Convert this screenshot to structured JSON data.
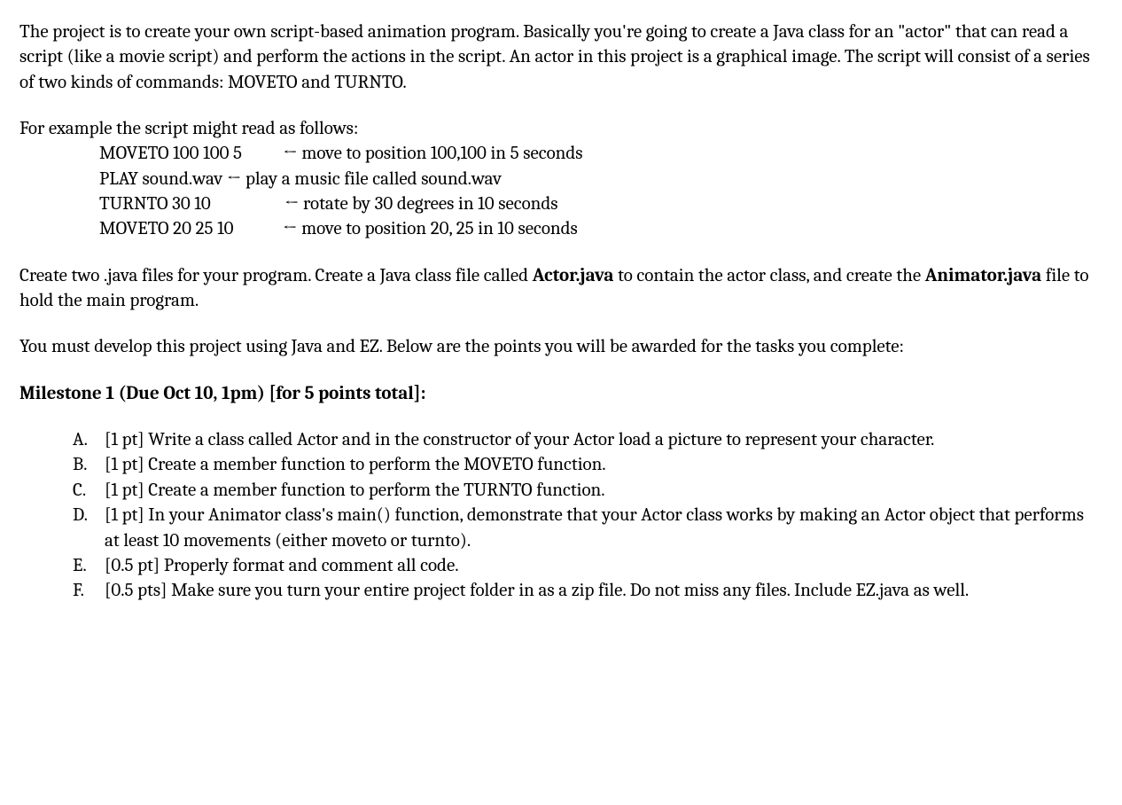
{
  "intro": "The project is to create your own script-based animation program. Basically you're going to create a Java class for an \"actor\" that can read a script (like a movie script) and perform the actions in the script.  An actor in this project is a graphical image. The script will consist of a series of two kinds of commands: MOVETO and TURNTO.",
  "example_lead": "For example the script might read as follows:",
  "script": [
    {
      "cmd": "MOVETO 100 100 5",
      "pad": "          ",
      "desc": "move to position 100,100 in 5 seconds"
    },
    {
      "cmd": "PLAY sound.wav ",
      "pad": "",
      "desc": "play a music file called sound.wav"
    },
    {
      "cmd": "TURNTO 30 10",
      "pad": "                  ",
      "desc": "rotate by 30 degrees in 10 seconds"
    },
    {
      "cmd": "MOVETO 20 25 10",
      "pad": "            ",
      "desc": "move to position 20, 25 in 10 seconds"
    }
  ],
  "arrow": "← ",
  "files_p_pre": "Create two .java files for your program. Create a Java class file called ",
  "files_actor": "Actor.java",
  "files_mid": " to contain the actor class, and create the ",
  "files_anim": "Animator.java",
  "files_post": " file to hold the main program.",
  "dev_p": "You must develop this project using Java and EZ. Below are the points you will be awarded for the tasks you complete:",
  "milestone": "Milestone 1 (Due Oct 10, 1pm) [for 5 points total]:",
  "tasks": [
    {
      "marker": "A.",
      "text": "[1 pt] Write a class called Actor and in the constructor of your Actor load a picture to represent your character."
    },
    {
      "marker": "B.",
      "text": "[1 pt] Create a member function to perform the MOVETO function."
    },
    {
      "marker": "C.",
      "text": "[1 pt] Create a member function to perform the TURNTO function."
    },
    {
      "marker": "D.",
      "text": "[1 pt] In your Animator class's main() function, demonstrate that your Actor class works by making an Actor object that performs at least 10 movements (either moveto or turnto)."
    },
    {
      "marker": "E.",
      "text": "[0.5 pt] Properly format and comment all code."
    },
    {
      "marker": "F.",
      "text": "[0.5 pts] Make sure you turn your entire project folder in as a zip file. Do not miss any files. Include EZ.java as well."
    }
  ]
}
